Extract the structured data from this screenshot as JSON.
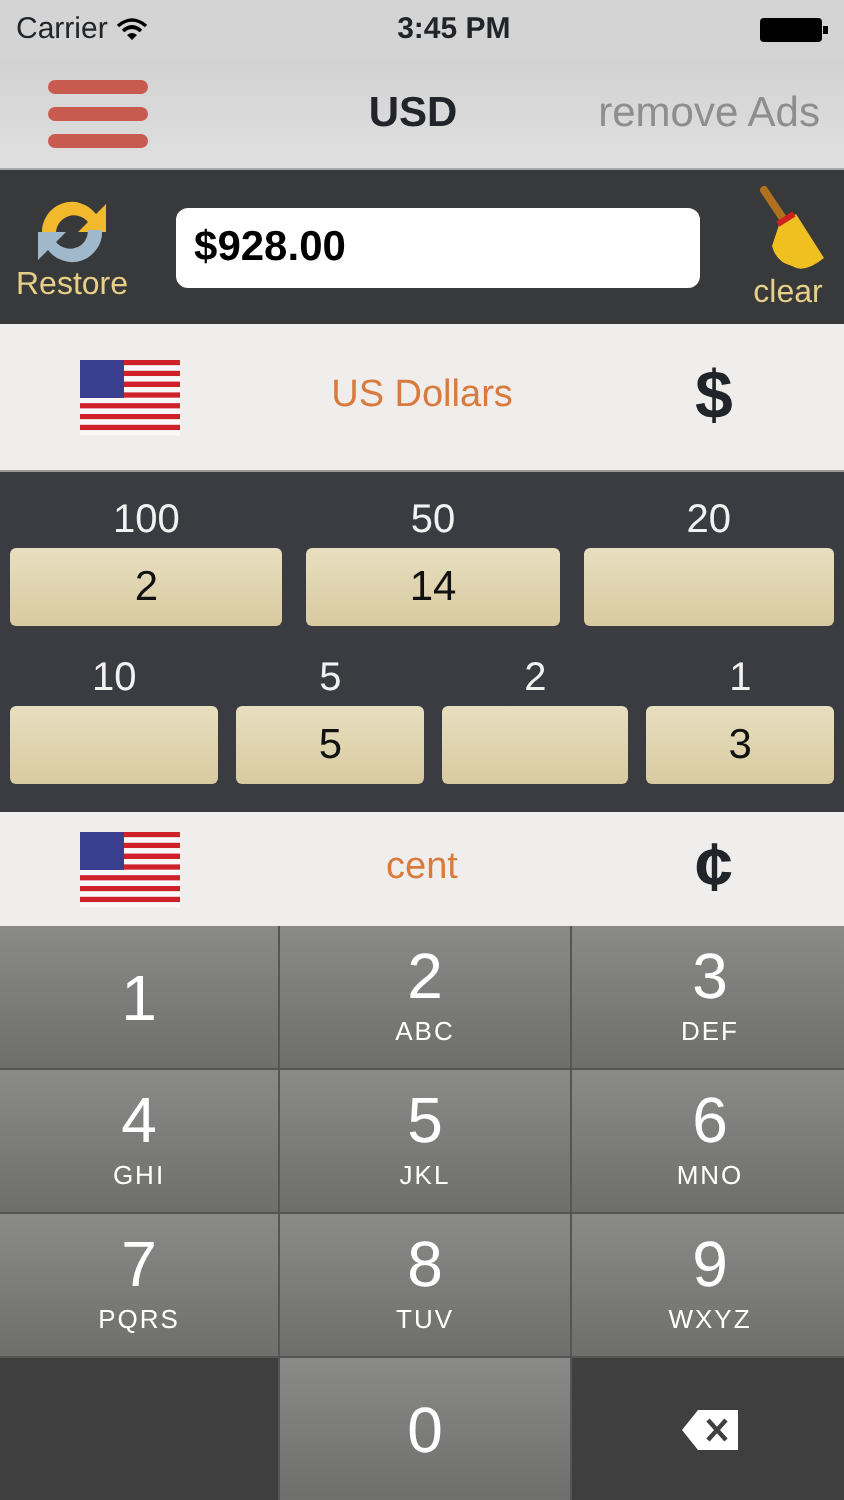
{
  "status_bar": {
    "carrier": "Carrier",
    "time": "3:45 PM"
  },
  "nav": {
    "title": "USD",
    "right_action": "remove Ads"
  },
  "toolbar": {
    "restore_label": "Restore",
    "amount": "$928.00",
    "clear_label": "clear"
  },
  "currency": {
    "name": "US Dollars",
    "symbol": "$"
  },
  "denomination_rows": [
    [
      {
        "label": "100",
        "count": "2"
      },
      {
        "label": "50",
        "count": "14"
      },
      {
        "label": "20"
      }
    ],
    [
      {
        "label": "10"
      },
      {
        "label": "5",
        "count": "5"
      },
      {
        "label": "2"
      },
      {
        "label": "1",
        "count": "3"
      }
    ]
  ],
  "subunit": {
    "name": "cent",
    "symbol": "¢"
  },
  "keypad": [
    {
      "kind": "digit",
      "digit": "1"
    },
    {
      "kind": "digit",
      "digit": "2",
      "letters": "ABC"
    },
    {
      "kind": "digit",
      "digit": "3",
      "letters": "DEF"
    },
    {
      "kind": "digit",
      "digit": "4",
      "letters": "GHI"
    },
    {
      "kind": "digit",
      "digit": "5",
      "letters": "JKL"
    },
    {
      "kind": "digit",
      "digit": "6",
      "letters": "MNO"
    },
    {
      "kind": "digit",
      "digit": "7",
      "letters": "PQRS"
    },
    {
      "kind": "digit",
      "digit": "8",
      "letters": "TUV"
    },
    {
      "kind": "digit",
      "digit": "9",
      "letters": "WXYZ"
    },
    {
      "kind": "blank"
    },
    {
      "kind": "digit",
      "digit": "0"
    },
    {
      "kind": "backspace"
    }
  ]
}
